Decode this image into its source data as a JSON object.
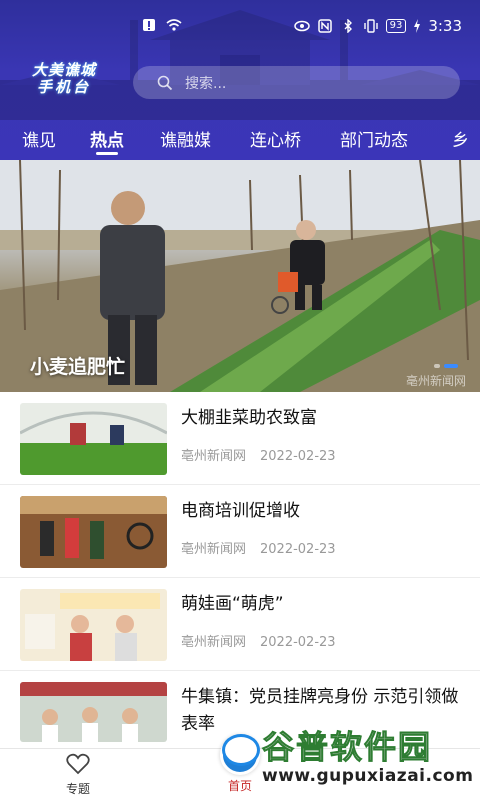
{
  "status_bar": {
    "time": "3:33",
    "battery": "93",
    "icons": [
      "notification-icon",
      "wifi-icon",
      "eye-icon",
      "nfc-icon",
      "bluetooth-icon",
      "vibrate-icon",
      "charging-icon"
    ]
  },
  "header": {
    "logo_line1": "大美谯城",
    "logo_line2": "手机台",
    "search_placeholder": "搜索..."
  },
  "tabs": [
    "谯见",
    "热点",
    "谯融媒",
    "连心桥",
    "部门动态",
    "乡"
  ],
  "active_tab": "热点",
  "banner": {
    "caption": "小麦追肥忙",
    "source": "亳州新闻网",
    "slide_count": 2,
    "current_slide": 2
  },
  "news": [
    {
      "title": "大棚韭菜助农致富",
      "source": "亳州新闻网",
      "date": "2022-02-23"
    },
    {
      "title": "电商培训促增收",
      "source": "亳州新闻网",
      "date": "2022-02-23"
    },
    {
      "title": "萌娃画“萌虎”",
      "source": "亳州新闻网",
      "date": "2022-02-23"
    },
    {
      "title": "牛集镇：党员挂牌亮身份 示范引领做表率",
      "source": "",
      "date": ""
    }
  ],
  "bottom_nav": {
    "topics": "专题",
    "home": "首页"
  },
  "watermark": {
    "brand": "谷普软件园",
    "url": "www.gupuxiazai.com"
  },
  "colors": {
    "header": "#3a36b4",
    "accent": "#1f7fd6",
    "home_active": "#c62828"
  }
}
